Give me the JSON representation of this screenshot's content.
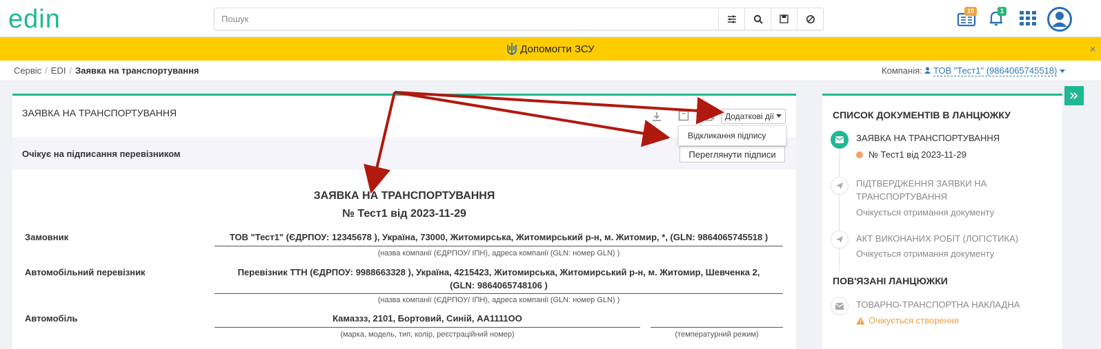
{
  "colors": {
    "accent": "#20b892",
    "banner": "#ffcc00",
    "link": "#2a7ab8",
    "annotation_arrow": "#b0190e"
  },
  "header": {
    "logo_text": "edin",
    "search_placeholder": "Пошук",
    "archive_badge": "10",
    "notifications_badge": "1"
  },
  "banner": {
    "text": "Допомогти ЗСУ",
    "close": "×"
  },
  "breadcrumb": {
    "items": [
      "Сервіс",
      "EDI"
    ],
    "separator": "/",
    "current": "Заявка на транспортування"
  },
  "company": {
    "label": "Компанія:",
    "value": "ТОВ \"Тест1\" (9864065745518)"
  },
  "document": {
    "header_title": "ЗАЯВКА НА ТРАНСПОРТУВАННЯ",
    "extra_actions_button": "Додаткові дії",
    "dropdown_item": "Відкликання підпису",
    "status_text": "Очікує на підписання перевізником",
    "view_signatures_button": "Переглянути підписи",
    "title": "ЗАЯВКА НА ТРАНСПОРТУВАННЯ",
    "subtitle": "№ Тест1 від 2023-11-29",
    "rows": {
      "customer": {
        "label": "Замовник",
        "value": "ТОВ \"Тест1\" (ЄДРПОУ: 12345678 ), Україна, 73000, Житомирська, Житомирський р-н, м. Житомир, *, (GLN: 9864065745518 )",
        "hint": "(назва компанії (ЄДРПОУ/ ІПН), адреса компанії (GLN: номер GLN) )"
      },
      "carrier": {
        "label": "Автомобільний перевізник",
        "value_line1": "Перевізник ТТН (ЄДРПОУ: 9988663328 ), Україна, 4215423, Житомирська, Житомирський р-н, м. Житомир, Шевченка 2,",
        "value_line2": "(GLN: 9864065748106 )",
        "hint": "(назва компанії (ЄДРПОУ/ ІПН), адреса компанії (GLN: номер GLN) )"
      },
      "vehicle": {
        "label": "Автомобіль",
        "value": "Камаззз, 2101, Бортовий, Синій, АА1111ОО",
        "hint": "(марка, модель, тип, колір, реєстраційний номер)",
        "temp_hint": "(температурний режим)"
      }
    }
  },
  "sidebar": {
    "chain_heading": "СПИСОК ДОКУМЕНТІВ В ЛАНЦЮЖКУ",
    "chain": [
      {
        "title": "ЗАЯВКА НА ТРАНСПОРТУВАННЯ",
        "number": "№ Тест1 від 2023-11-29"
      },
      {
        "title_line1": "ПІДТВЕРДЖЕННЯ ЗАЯВКИ НА",
        "title_line2": "ТРАНСПОРТУВАННЯ",
        "status": "Очікується отримання документу"
      },
      {
        "title": "АКТ ВИКОНАНИХ РОБІТ (ЛОГІСТИКА)",
        "status": "Очікується отримання документу"
      }
    ],
    "related_heading": "ПОВ'ЯЗАНІ ЛАНЦЮЖКИ",
    "related": [
      {
        "title": "ТОВАРНО-ТРАНСПОРТНА НАКЛАДНА",
        "status": "Очікується створення"
      }
    ]
  }
}
